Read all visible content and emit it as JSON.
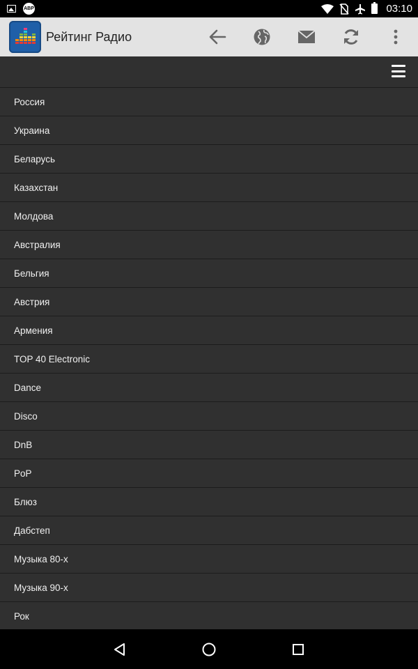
{
  "status_bar": {
    "time": "03:10",
    "left_icons": [
      "image-icon",
      "abp-icon"
    ],
    "abp_label": "ABP",
    "right_icons": [
      "wifi-icon",
      "no-sim-icon",
      "airplane-icon",
      "battery-icon"
    ]
  },
  "action_bar": {
    "title": "Рейтинг Радио",
    "actions": [
      "back-arrow-icon",
      "globe-icon",
      "mail-icon",
      "refresh-icon",
      "overflow-menu-icon"
    ]
  },
  "sub_bar": {
    "menu_icon": "hamburger-menu-icon"
  },
  "list": {
    "items": [
      "Россия",
      "Украина",
      "Беларусь",
      "Казахстан",
      "Молдова",
      "Австралия",
      "Бельгия",
      "Австрия",
      "Армения",
      "TOP 40 Electronic",
      "Dance",
      "Disco",
      "DnB",
      "PoP",
      "Блюз",
      "Дабстеп",
      "Музыка 80-х",
      "Музыка 90-х",
      "Рок"
    ]
  },
  "nav_bar": {
    "buttons": [
      "back-icon",
      "home-icon",
      "recents-icon"
    ]
  },
  "colors": {
    "status_bar": "#000000",
    "action_bar": "#e3e3e3",
    "list_background": "#303030",
    "divider": "#1c1c1c",
    "text": "#f0f0f0",
    "app_icon": "#1f5fa8"
  }
}
